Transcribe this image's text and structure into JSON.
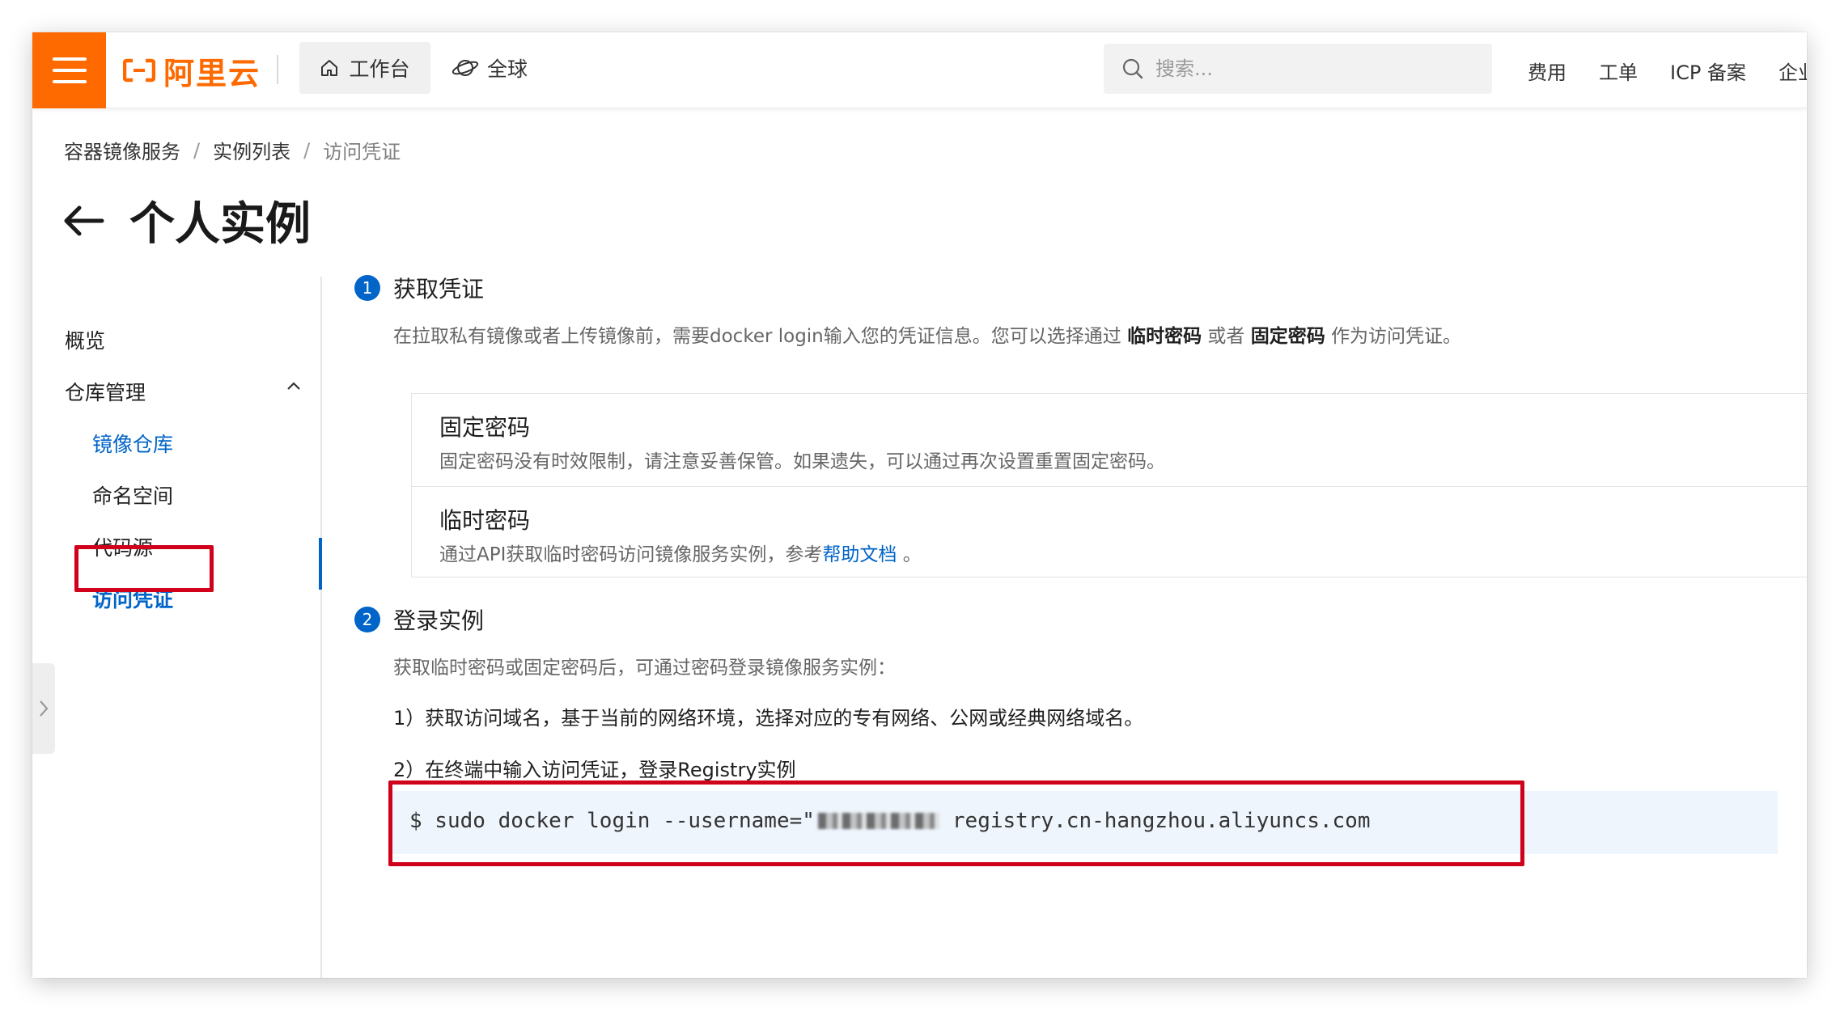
{
  "topbar": {
    "logo_text": "阿里云",
    "workbench_label": "工作台",
    "global_label": "全球",
    "search_placeholder": "搜索...",
    "links": [
      "费用",
      "工单",
      "ICP 备案",
      "企业"
    ],
    "brand_color": "#ff6a00"
  },
  "breadcrumb": {
    "items": [
      "容器镜像服务",
      "实例列表",
      "访问凭证"
    ],
    "separator": "/"
  },
  "page": {
    "title": "个人实例"
  },
  "sidebar": {
    "overview": "概览",
    "repo_management": "仓库管理",
    "items": [
      "镜像仓库",
      "命名空间",
      "代码源",
      "访问凭证"
    ],
    "selected": "访问凭证"
  },
  "step1": {
    "number": "1",
    "title": "获取凭证",
    "desc_prefix": "在拉取私有镜像或者上传镜像前，需要docker login输入您的凭证信息。您可以选择通过",
    "desc_temp": "临时密码",
    "desc_or": "或者",
    "desc_fixed": "固定密码",
    "desc_suffix": "作为访问凭证。",
    "fixed": {
      "title": "固定密码",
      "desc": "固定密码没有时效限制，请注意妥善保管。如果遗失，可以通过再次设置重置固定密码。"
    },
    "temp": {
      "title": "临时密码",
      "desc_prefix": "通过API获取临时密码访问镜像服务实例，参考",
      "link": "帮助文档",
      "desc_suffix": "。"
    }
  },
  "step2": {
    "number": "2",
    "title": "登录实例",
    "desc": "获取临时密码或固定密码后，可通过密码登录镜像服务实例：",
    "instr1": "1）获取访问域名，基于当前的网络环境，选择对应的专有网络、公网或经典网络域名。",
    "instr2": "2）在终端中输入访问凭证，登录Registry实例",
    "code_prefix": "$ sudo docker login --username=\"",
    "code_suffix": "registry.cn-hangzhou.aliyuncs.com"
  },
  "colors": {
    "accent": "#0064c8",
    "highlight_red": "#d0021b"
  }
}
